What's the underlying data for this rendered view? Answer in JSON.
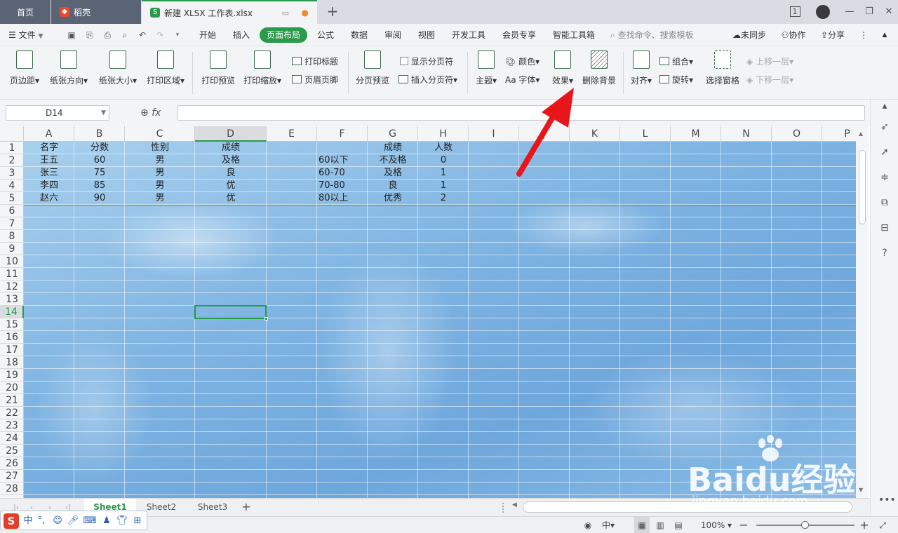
{
  "tabs": {
    "home": "首页",
    "daoke": "稻壳",
    "file": "新建 XLSX 工作表.xlsx"
  },
  "window": {
    "badge": "1",
    "minimize": "—",
    "restore": "❐",
    "close": "✕"
  },
  "menus": [
    "文件",
    "开始",
    "插入",
    "页面布局",
    "公式",
    "数据",
    "审阅",
    "视图",
    "开发工具",
    "会员专享",
    "智能工具箱"
  ],
  "menu_active": "页面布局",
  "search_placeholder": "查找命令、搜索模板",
  "menu_right": {
    "sync": "未同步",
    "collab": "协作",
    "share": "分享"
  },
  "ribbon": {
    "margins": "页边距",
    "orientation": "纸张方向",
    "size": "纸张大小",
    "print_area": "打印区域",
    "print_preview": "打印预览",
    "print_scale": "打印缩放",
    "print_titles": "打印标题",
    "header_footer": "页眉页脚",
    "page_break_preview": "分页预览",
    "show_page_breaks": "显示分页符",
    "insert_page_break": "插入分页符",
    "theme": "主题",
    "colors": "颜色",
    "fonts": "字体",
    "effects": "效果",
    "delete_background": "删除背景",
    "align": "对齐",
    "group": "组合",
    "rotate": "旋转",
    "selection_pane": "选择窗格",
    "bring_forward": "上移一层",
    "send_backward": "下移一层"
  },
  "namebox": "D14",
  "fx_label": "fx",
  "columns": [
    "A",
    "B",
    "C",
    "D",
    "E",
    "F",
    "G",
    "H",
    "I",
    "J",
    "K",
    "L",
    "M",
    "N",
    "O",
    "P"
  ],
  "selected_column": "D",
  "rows": [
    "1",
    "2",
    "3",
    "4",
    "5",
    "6",
    "7",
    "8",
    "9",
    "10",
    "11",
    "12",
    "13",
    "14",
    "15",
    "16",
    "17",
    "18",
    "19",
    "20",
    "21",
    "22",
    "23",
    "24",
    "25",
    "26",
    "27",
    "28"
  ],
  "selected_row": "14",
  "cells": {
    "A": [
      "名字",
      "王五",
      "张三",
      "李四",
      "赵六"
    ],
    "B": [
      "分数",
      "60",
      "75",
      "85",
      "90"
    ],
    "C": [
      "性别",
      "男",
      "男",
      "男",
      "男"
    ],
    "D": [
      "成绩",
      "及格",
      "良",
      "优",
      "优"
    ],
    "F": [
      "",
      "60以下",
      "60-70",
      "70-80",
      "80以上"
    ],
    "G": [
      "成绩",
      "不及格",
      "及格",
      "良",
      "优秀"
    ],
    "H": [
      "人数",
      "0",
      "1",
      "1",
      "2"
    ]
  },
  "sheets": [
    "Sheet1",
    "Sheet2",
    "Sheet3"
  ],
  "active_sheet": "Sheet1",
  "status": {
    "zoom": "100%",
    "zoom_level_percent": 50
  },
  "ime": {
    "logo": "S",
    "mode": "中"
  },
  "watermark": {
    "brand": "Baidu经验",
    "url": "jingyan.baidu.com"
  },
  "colors": {
    "accent": "#2a9a4c",
    "arrow": "#e8161b"
  }
}
